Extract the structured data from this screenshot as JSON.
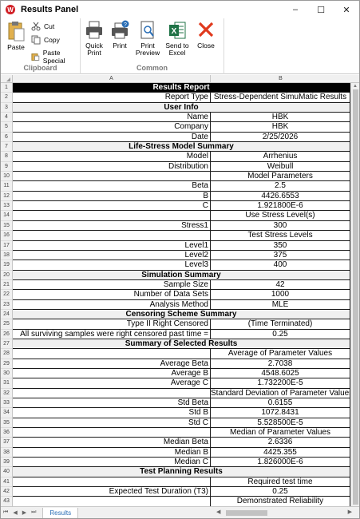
{
  "window": {
    "title": "Results Panel",
    "icon_letter": "W",
    "min": "–",
    "max": "☐",
    "close": "✕"
  },
  "ribbon": {
    "clipboard": {
      "label": "Clipboard",
      "paste": "Paste",
      "cut": "Cut",
      "copy": "Copy",
      "paste_special": "Paste Special"
    },
    "common": {
      "label": "Common",
      "quick_print_1": "Quick",
      "quick_print_2": "Print",
      "print": "Print",
      "print_preview_1": "Print",
      "print_preview_2": "Preview",
      "send_excel_1": "Send to",
      "send_excel_2": "Excel",
      "close": "Close"
    }
  },
  "sheet": {
    "col_a": "A",
    "col_b": "B",
    "rows": [
      {
        "n": "1",
        "merged": "Results Report",
        "style": "title"
      },
      {
        "n": "2",
        "a": "Report Type",
        "b": "Stress-Dependent SimuMatic Results"
      },
      {
        "n": "3",
        "merged": "User Info"
      },
      {
        "n": "4",
        "a": "Name",
        "b": "HBK"
      },
      {
        "n": "5",
        "a": "Company",
        "b": "HBK"
      },
      {
        "n": "6",
        "a": "Date",
        "b": "2/25/2026"
      },
      {
        "n": "7",
        "merged": "Life-Stress Model Summary"
      },
      {
        "n": "8",
        "a": "Model",
        "b": "Arrhenius"
      },
      {
        "n": "9",
        "a": "Distribution",
        "b": "Weibull"
      },
      {
        "n": "10",
        "a": "",
        "b": "Model Parameters"
      },
      {
        "n": "11",
        "a": "Beta",
        "b": "2.5"
      },
      {
        "n": "12",
        "a": "B",
        "b": "4426.6553"
      },
      {
        "n": "13",
        "a": "C",
        "b": "1.921800E-6"
      },
      {
        "n": "14",
        "a": "",
        "b": "Use Stress Level(s)"
      },
      {
        "n": "15",
        "a": "Stress1",
        "b": "300"
      },
      {
        "n": "16",
        "a": "",
        "b": "Test Stress Levels"
      },
      {
        "n": "17",
        "a": "Level1",
        "b": "350"
      },
      {
        "n": "18",
        "a": "Level2",
        "b": "375"
      },
      {
        "n": "19",
        "a": "Level3",
        "b": "400"
      },
      {
        "n": "20",
        "merged": "Simulation Summary"
      },
      {
        "n": "21",
        "a": "Sample Size",
        "b": "42"
      },
      {
        "n": "22",
        "a": "Number of Data Sets",
        "b": "1000"
      },
      {
        "n": "23",
        "a": "Analysis Method",
        "b": "MLE"
      },
      {
        "n": "24",
        "merged": "Censoring Scheme Summary"
      },
      {
        "n": "25",
        "a": "Type II Right Censored",
        "b": "(Time Terminated)"
      },
      {
        "n": "26",
        "a": "All surviving samples were right censored past time =",
        "b": "0.25"
      },
      {
        "n": "27",
        "merged": "Summary of Selected Results"
      },
      {
        "n": "28",
        "a": "",
        "b": "Average of Parameter Values"
      },
      {
        "n": "29",
        "a": "Average Beta",
        "b": "2.7038"
      },
      {
        "n": "30",
        "a": "Average B",
        "b": "4548.6025"
      },
      {
        "n": "31",
        "a": "Average C",
        "b": "1.732200E-5"
      },
      {
        "n": "32",
        "a": "",
        "b": "Standard Deviation of Parameter Values"
      },
      {
        "n": "33",
        "a": "Std Beta",
        "b": "0.6155"
      },
      {
        "n": "34",
        "a": "Std B",
        "b": "1072.8431"
      },
      {
        "n": "35",
        "a": "Std C",
        "b": "5.528500E-5"
      },
      {
        "n": "36",
        "a": "",
        "b": "Median of Parameter Values"
      },
      {
        "n": "37",
        "a": "Median Beta",
        "b": "2.6336"
      },
      {
        "n": "38",
        "a": "Median B",
        "b": "4425.355"
      },
      {
        "n": "39",
        "a": "Median C",
        "b": "1.826000E-6"
      },
      {
        "n": "40",
        "merged": "Test Planning Results"
      },
      {
        "n": "41",
        "a": "",
        "b": "Required test time"
      },
      {
        "n": "42",
        "a": "Expected Test Duration (T3)",
        "b": "0.25"
      },
      {
        "n": "43",
        "a": "",
        "b": "Demonstrated Reliability"
      }
    ]
  },
  "tabs": {
    "active": "Results"
  },
  "nav": {
    "first": "⏮",
    "prev": "◀",
    "next": "▶",
    "last": "⏭"
  }
}
